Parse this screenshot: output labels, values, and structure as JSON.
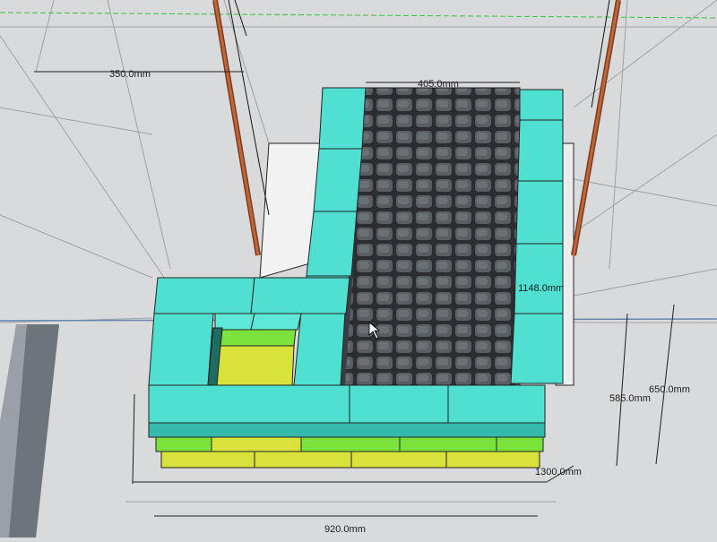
{
  "app": {
    "viewport_label": "3D model viewport"
  },
  "colors": {
    "background": "#d9dadb",
    "cyan_block": "#4fe0d2",
    "cyan_block_dark": "#36b9ad",
    "green_block": "#7be23c",
    "yellow_block": "#d9e23a",
    "paver": "#4a4d52",
    "paver_dark": "#2b2d31",
    "rod": "#a85a35",
    "edge": "#1a1a1a"
  },
  "dimensions": {
    "top_left": "350.0mm",
    "top_right": "405.0mm",
    "right_mid": "1148.0mm",
    "right_a": "585.0mm",
    "right_b": "650.0mm",
    "right_c": "1300.0mm",
    "bottom": "920.0mm"
  }
}
